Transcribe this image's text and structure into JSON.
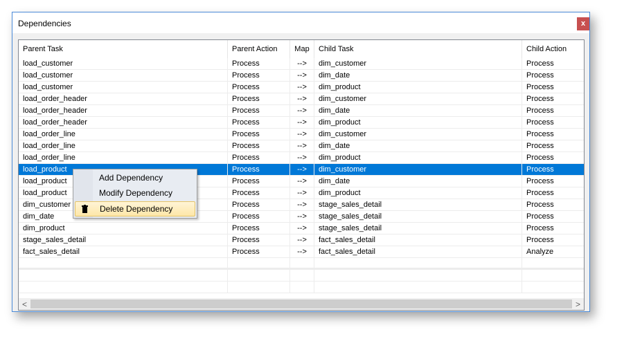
{
  "window": {
    "title": "Dependencies",
    "close_label": "x"
  },
  "columns": [
    "Parent Task",
    "Parent Action",
    "Map",
    "Child Task",
    "Child Action"
  ],
  "rows": [
    [
      "load_customer",
      "Process",
      "-->",
      "dim_customer",
      "Process"
    ],
    [
      "load_customer",
      "Process",
      "-->",
      "dim_date",
      "Process"
    ],
    [
      "load_customer",
      "Process",
      "-->",
      "dim_product",
      "Process"
    ],
    [
      "load_order_header",
      "Process",
      "-->",
      "dim_customer",
      "Process"
    ],
    [
      "load_order_header",
      "Process",
      "-->",
      "dim_date",
      "Process"
    ],
    [
      "load_order_header",
      "Process",
      "-->",
      "dim_product",
      "Process"
    ],
    [
      "load_order_line",
      "Process",
      "-->",
      "dim_customer",
      "Process"
    ],
    [
      "load_order_line",
      "Process",
      "-->",
      "dim_date",
      "Process"
    ],
    [
      "load_order_line",
      "Process",
      "-->",
      "dim_product",
      "Process"
    ],
    [
      "load_product",
      "Process",
      "-->",
      "dim_customer",
      "Process"
    ],
    [
      "load_product",
      "Process",
      "-->",
      "dim_date",
      "Process"
    ],
    [
      "load_product",
      "Process",
      "-->",
      "dim_product",
      "Process"
    ],
    [
      "dim_customer",
      "Process",
      "-->",
      "stage_sales_detail",
      "Process"
    ],
    [
      "dim_date",
      "Process",
      "-->",
      "stage_sales_detail",
      "Process"
    ],
    [
      "dim_product",
      "Process",
      "-->",
      "stage_sales_detail",
      "Process"
    ],
    [
      "stage_sales_detail",
      "Process",
      "-->",
      "fact_sales_detail",
      "Process"
    ],
    [
      "fact_sales_detail",
      "Process",
      "-->",
      "fact_sales_detail",
      "Analyze"
    ]
  ],
  "selected_row": 9,
  "context_menu": {
    "items": [
      "Add Dependency",
      "Modify Dependency",
      "Delete Dependency"
    ],
    "highlighted": 2,
    "icons": {
      "2": "trash-icon"
    }
  },
  "scrollbar": {
    "left_arrow": "<",
    "right_arrow": ">"
  }
}
